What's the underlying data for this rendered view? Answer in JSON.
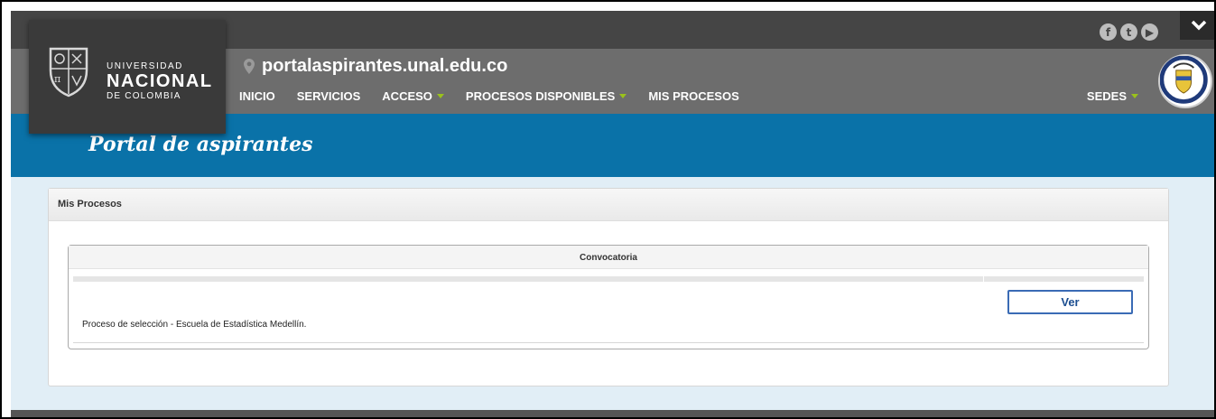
{
  "brand": {
    "line1": "UNIVERSIDAD",
    "line2": "NACIONAL",
    "line3": "DE COLOMBIA"
  },
  "social": {
    "icons": [
      "facebook-icon",
      "twitter-icon",
      "youtube-icon"
    ],
    "glyphs": [
      "f",
      "t",
      "▶"
    ]
  },
  "domain": "portalaspirantes.unal.edu.co",
  "nav": {
    "items": [
      {
        "label": "INICIO",
        "dropdown": false
      },
      {
        "label": "SERVICIOS",
        "dropdown": false
      },
      {
        "label": "ACCESO",
        "dropdown": true
      },
      {
        "label": "PROCESOS DISPONIBLES",
        "dropdown": true
      },
      {
        "label": "MIS PROCESOS",
        "dropdown": false
      }
    ],
    "sedes": "SEDES"
  },
  "banner_title": "Portal de aspirantes",
  "panel": {
    "title": "Mis Procesos",
    "table": {
      "header": "Convocatoria",
      "rows": [
        {
          "text": "Proceso de selección - Escuela de Estadística Medellín.",
          "button": "Ver"
        }
      ]
    }
  },
  "colors": {
    "topbar": "#454545",
    "navbar": "#6d6d6d",
    "banner": "#0a72a8",
    "content_bg": "#e1eef6",
    "accent_caret": "#9ac21c",
    "button_border": "#3a6bb5"
  }
}
